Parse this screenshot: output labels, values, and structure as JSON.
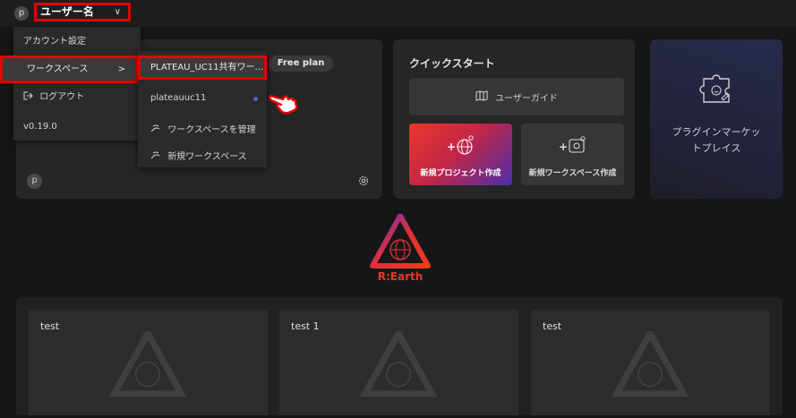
{
  "header": {
    "avatar_letter": "p",
    "user_name": "ユーザー名",
    "chevron": "∨"
  },
  "account_menu": {
    "items": [
      {
        "label": "アカウント設定"
      },
      {
        "label": "ワークスペース",
        "chevron": ">"
      },
      {
        "label": "ログアウト",
        "icon": "logout-icon"
      },
      {
        "label": "v0.19.0"
      }
    ]
  },
  "workspace_submenu": {
    "selected": "PLATEAU_UC11共有ワー...",
    "items": [
      {
        "label": "plateauuc11"
      },
      {
        "label": "ワークスペースを管理",
        "icon": "manage-workspace-icon"
      },
      {
        "label": "新規ワークスペース",
        "icon": "new-workspace-icon"
      }
    ]
  },
  "workspace_card": {
    "plan": "Free plan",
    "avatar_letter": "p"
  },
  "quick_start": {
    "title": "クイックスタート",
    "user_guide": "ユーザーガイド",
    "new_project": "新規プロジェクト作成",
    "new_workspace": "新規ワークスペース作成"
  },
  "plugin_marketplace": {
    "label": "プラグインマーケットプレイス"
  },
  "logo": {
    "text": "R:Earth"
  },
  "projects": [
    {
      "name": "test"
    },
    {
      "name": "test 1"
    },
    {
      "name": "test"
    }
  ],
  "colors": {
    "highlight": "#e60000",
    "accent_blue": "#4a5fe0",
    "brand_red": "#e8382a"
  }
}
